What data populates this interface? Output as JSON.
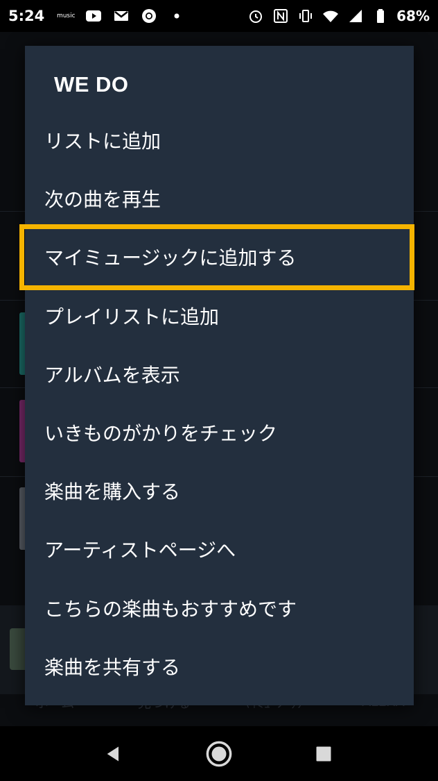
{
  "status_bar": {
    "time": "5:24",
    "music_label": "music",
    "battery_percent": "68%"
  },
  "dialog": {
    "title": "WE DO",
    "items": [
      {
        "label": "リストに追加"
      },
      {
        "label": "次の曲を再生"
      },
      {
        "label": "マイミュージックに追加する"
      },
      {
        "label": "プレイリストに追加"
      },
      {
        "label": "アルバムを表示"
      },
      {
        "label": "いきものがかりをチェック"
      },
      {
        "label": "楽曲を購入する"
      },
      {
        "label": "アーティストページへ"
      },
      {
        "label": "こちらの楽曲もおすすめです"
      },
      {
        "label": "楽曲を共有する"
      }
    ],
    "highlighted_index": 2,
    "highlight_color": "#f5b400",
    "background_color": "#232f3e"
  },
  "bottom_nav": {
    "items": [
      {
        "label": "ホーム"
      },
      {
        "label": "見つける"
      },
      {
        "label": "ﾏｲﾐｭｰｼﾞｯｸ"
      },
      {
        "label": "ALEXA"
      }
    ]
  },
  "system_nav": {
    "icons": [
      "back-icon",
      "home-icon",
      "recents-icon"
    ]
  }
}
